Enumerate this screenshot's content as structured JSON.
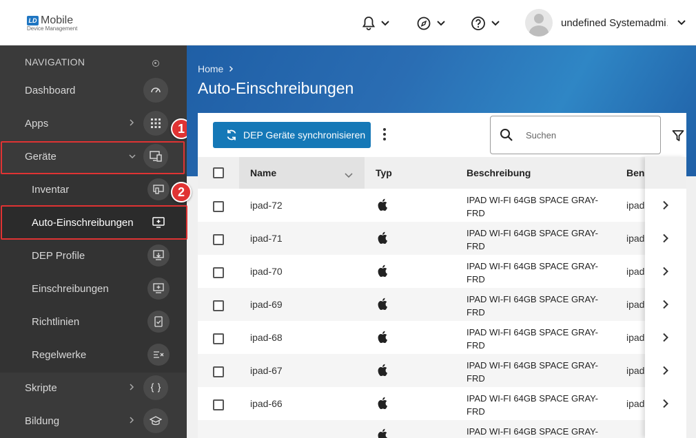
{
  "logo": {
    "badge": "LD",
    "title": "Mobile",
    "subtitle": "Device Management"
  },
  "user": {
    "name": "undefined Systemadmi…"
  },
  "sidebar": {
    "header": "NAVIGATION",
    "items": [
      {
        "label": "Dashboard"
      },
      {
        "label": "Apps"
      },
      {
        "label": "Geräte"
      },
      {
        "label": "Inventar"
      },
      {
        "label": "Auto-Einschreibungen"
      },
      {
        "label": "DEP Profile"
      },
      {
        "label": "Einschreibungen"
      },
      {
        "label": "Richtlinien"
      },
      {
        "label": "Regelwerke"
      },
      {
        "label": "Skripte"
      },
      {
        "label": "Bildung"
      }
    ]
  },
  "markers": [
    "1",
    "2"
  ],
  "breadcrumb": "Home",
  "page_title": "Auto-Einschreibungen",
  "toolbar": {
    "sync_label": "DEP Geräte synchronisieren",
    "search_placeholder": "Suchen"
  },
  "table": {
    "columns": [
      "Name",
      "Typ",
      "Beschreibung",
      "Benutzer"
    ],
    "user_col_visible": "Benu",
    "rows": [
      {
        "name": "ipad-72",
        "desc": "IPAD WI-FI 64GB SPACE GRAY-FRD",
        "user": "ipad"
      },
      {
        "name": "ipad-71",
        "desc": "IPAD WI-FI 64GB SPACE GRAY-FRD",
        "user": "ipad"
      },
      {
        "name": "ipad-70",
        "desc": "IPAD WI-FI 64GB SPACE GRAY-FRD",
        "user": "ipad"
      },
      {
        "name": "ipad-69",
        "desc": "IPAD WI-FI 64GB SPACE GRAY-FRD",
        "user": "ipad"
      },
      {
        "name": "ipad-68",
        "desc": "IPAD WI-FI 64GB SPACE GRAY-FRD",
        "user": "ipad"
      },
      {
        "name": "ipad-67",
        "desc": "IPAD WI-FI 64GB SPACE GRAY-FRD",
        "user": "ipad"
      },
      {
        "name": "ipad-66",
        "desc": "IPAD WI-FI 64GB SPACE GRAY-FRD",
        "user": "ipad"
      },
      {
        "name": "",
        "desc": "IPAD WI-FI 64GB SPACE GRAY-",
        "user": ""
      }
    ]
  },
  "colors": {
    "accent": "#1578b7",
    "sidebar": "#3a3a3a",
    "highlight": "#e03333"
  }
}
